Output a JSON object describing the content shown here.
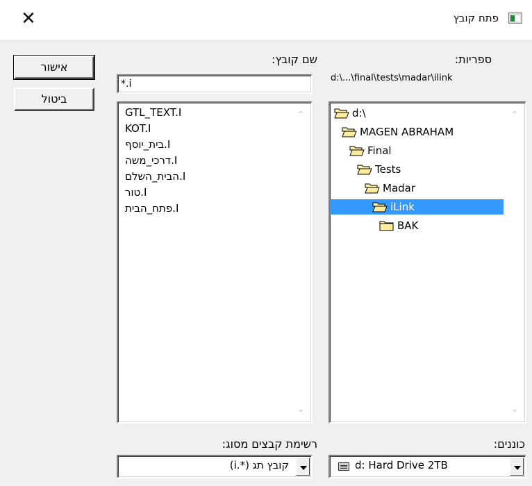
{
  "window": {
    "title": "פתח קובץ"
  },
  "filename": {
    "label": "שם קובץ:",
    "value": "*.i",
    "files": [
      "GTL_TEXT.I",
      "KOT.I",
      "בית_יוסף.I",
      "דרכי_משה.I",
      "הבית_השלם.I",
      "טור.I",
      "פתח_הבית.I"
    ]
  },
  "directories": {
    "label": "ספריות:",
    "current_path": "d:\\...\\final\\tests\\madar\\ilink",
    "tree": [
      {
        "label": "d:\\",
        "state": "open",
        "selected": false
      },
      {
        "label": "MAGEN ABRAHAM",
        "state": "open",
        "selected": false
      },
      {
        "label": "Final",
        "state": "open",
        "selected": false
      },
      {
        "label": "Tests",
        "state": "open",
        "selected": false
      },
      {
        "label": "Madar",
        "state": "open",
        "selected": false
      },
      {
        "label": "iLink",
        "state": "open",
        "selected": true
      },
      {
        "label": "BAK",
        "state": "closed",
        "selected": false
      }
    ]
  },
  "buttons": {
    "ok": "אישור",
    "cancel": "ביטול"
  },
  "filetype": {
    "label": "רשימת קבצים מסוג:",
    "value": "קובץ תג (*.i)"
  },
  "drives": {
    "label": "כוננים:",
    "value": "d: Hard Drive 2TB"
  },
  "icons": {
    "close": "close-icon",
    "folder_open": "folder-open-icon",
    "folder_closed": "folder-closed-icon",
    "drive": "hard-drive-icon"
  },
  "colors": {
    "selection": "#3399ff",
    "folder": "#ffeb9c"
  }
}
